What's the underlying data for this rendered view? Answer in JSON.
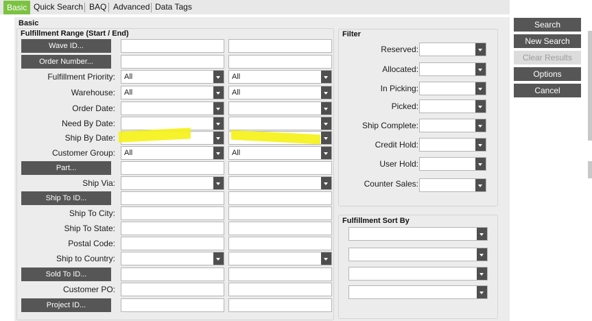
{
  "tabs": [
    {
      "label": "Basic",
      "active": true
    },
    {
      "label": "Quick Search"
    },
    {
      "label": "BAQ"
    },
    {
      "label": "Advanced"
    },
    {
      "label": "Data Tags"
    }
  ],
  "panel": {
    "title": "Basic",
    "range_title": "Fulfillment Range (Start / End)",
    "rows": [
      {
        "label": "Wave ID...",
        "kind": "button",
        "control": "text"
      },
      {
        "label": "Order Number...",
        "kind": "button",
        "control": "text"
      },
      {
        "label": "Fulfillment Priority:",
        "kind": "label",
        "control": "combo",
        "start": "All",
        "end": "All"
      },
      {
        "label": "Warehouse:",
        "kind": "label",
        "control": "combo",
        "start": "All",
        "end": "All"
      },
      {
        "label": "Order Date:",
        "kind": "label",
        "control": "combo",
        "start": "",
        "end": ""
      },
      {
        "label": "Need By Date:",
        "kind": "label",
        "control": "combo",
        "start": "",
        "end": ""
      },
      {
        "label": "Ship By Date:",
        "kind": "label",
        "control": "combo",
        "start": "",
        "end": "",
        "highlighted": true
      },
      {
        "label": "Customer Group:",
        "kind": "label",
        "control": "combo",
        "start": "All",
        "end": "All"
      },
      {
        "label": "Part...",
        "kind": "button",
        "control": "text"
      },
      {
        "label": "Ship Via:",
        "kind": "label",
        "control": "combo",
        "start": "",
        "end": ""
      },
      {
        "label": "Ship To ID...",
        "kind": "button",
        "control": "text"
      },
      {
        "label": "Ship To City:",
        "kind": "label",
        "control": "text"
      },
      {
        "label": "Ship To State:",
        "kind": "label",
        "control": "text"
      },
      {
        "label": "Postal Code:",
        "kind": "label",
        "control": "text"
      },
      {
        "label": "Ship to Country:",
        "kind": "label",
        "control": "combo",
        "start": "",
        "end": ""
      },
      {
        "label": "Sold To ID...",
        "kind": "button",
        "control": "text"
      },
      {
        "label": "Customer PO:",
        "kind": "label",
        "control": "text"
      },
      {
        "label": "Project ID...",
        "kind": "button",
        "control": "text"
      }
    ]
  },
  "filter": {
    "title": "Filter",
    "items": [
      {
        "label": "Reserved:"
      },
      {
        "label": "Allocated:"
      },
      {
        "label": "In Picking:"
      },
      {
        "label": "Picked:"
      },
      {
        "label": "Ship Complete:"
      },
      {
        "label": "Credit Hold:"
      },
      {
        "label": "User Hold:"
      },
      {
        "label": "Counter Sales:"
      }
    ]
  },
  "sort": {
    "title": "Fulfillment Sort By",
    "count": 4
  },
  "actions": [
    {
      "label": "Search"
    },
    {
      "label": "New Search"
    },
    {
      "label": "Clear Results",
      "disabled": true
    },
    {
      "label": "Options"
    },
    {
      "label": "Cancel"
    }
  ],
  "colors": {
    "active_tab": "#7cc242",
    "dark_button": "#565656",
    "highlight": "#f5f21a"
  }
}
